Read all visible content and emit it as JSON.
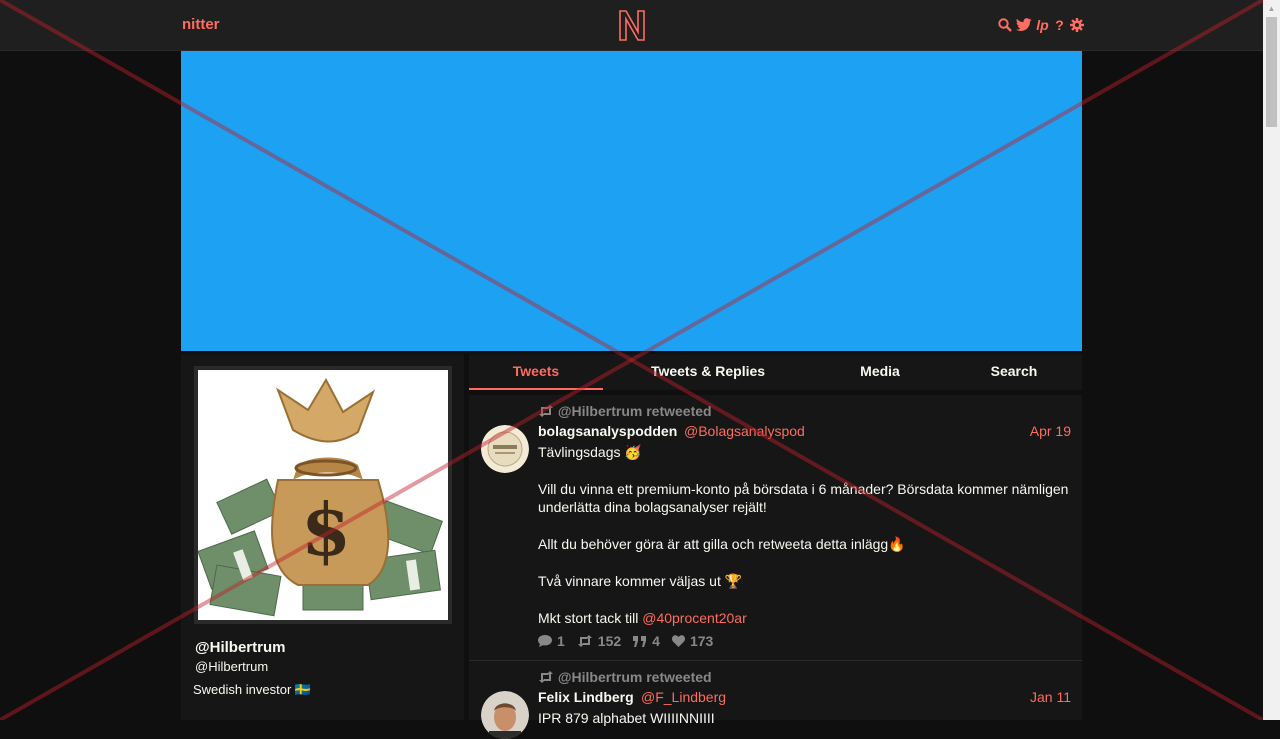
{
  "nav": {
    "brand": "nitter",
    "logo_letter": "N",
    "icons": [
      "search-icon",
      "twitter-icon",
      "lp-icon",
      "help-icon",
      "settings-icon"
    ],
    "lp_label": "lp",
    "help_label": "?"
  },
  "banner": {
    "color": "#1da1f2"
  },
  "profile": {
    "fullname": "@Hilbertrum",
    "username": "@Hilbertrum",
    "bio": "Swedish investor 🇸🇪"
  },
  "tabs": [
    {
      "label": "Tweets",
      "active": true
    },
    {
      "label": "Tweets & Replies",
      "active": false
    },
    {
      "label": "Media",
      "active": false
    },
    {
      "label": "Search",
      "active": false
    }
  ],
  "tweets": [
    {
      "retweet_header": "@Hilbertrum retweeted",
      "name": "bolagsanalyspodden",
      "handle": "@Bolagsanalyspod",
      "date": "Apr 19",
      "lines": [
        "Tävlingsdags 🥳",
        "Vill du vinna ett premium-konto på börsdata i 6 månader? Börsdata kommer nämligen underlätta dina bolagsanalyser rejält!",
        "Allt du behöver göra är att gilla och retweeta detta inlägg🔥",
        "Två vinnare kommer väljas ut 🏆",
        "Mkt stort tack till "
      ],
      "mention": "@40procent20ar",
      "stats": {
        "comments": "1",
        "retweets": "152",
        "quotes": "4",
        "likes": "173"
      }
    },
    {
      "retweet_header": "@Hilbertrum retweeted",
      "name": "Felix Lindberg",
      "handle": "@F_Lindberg",
      "date": "Jan 11",
      "first_line": "IPR 879 alphabet WIIIINNIIII"
    }
  ],
  "colors": {
    "accent": "#ff6c60",
    "bg": "#0f0f0f",
    "panel": "#161616",
    "muted": "#888889"
  }
}
